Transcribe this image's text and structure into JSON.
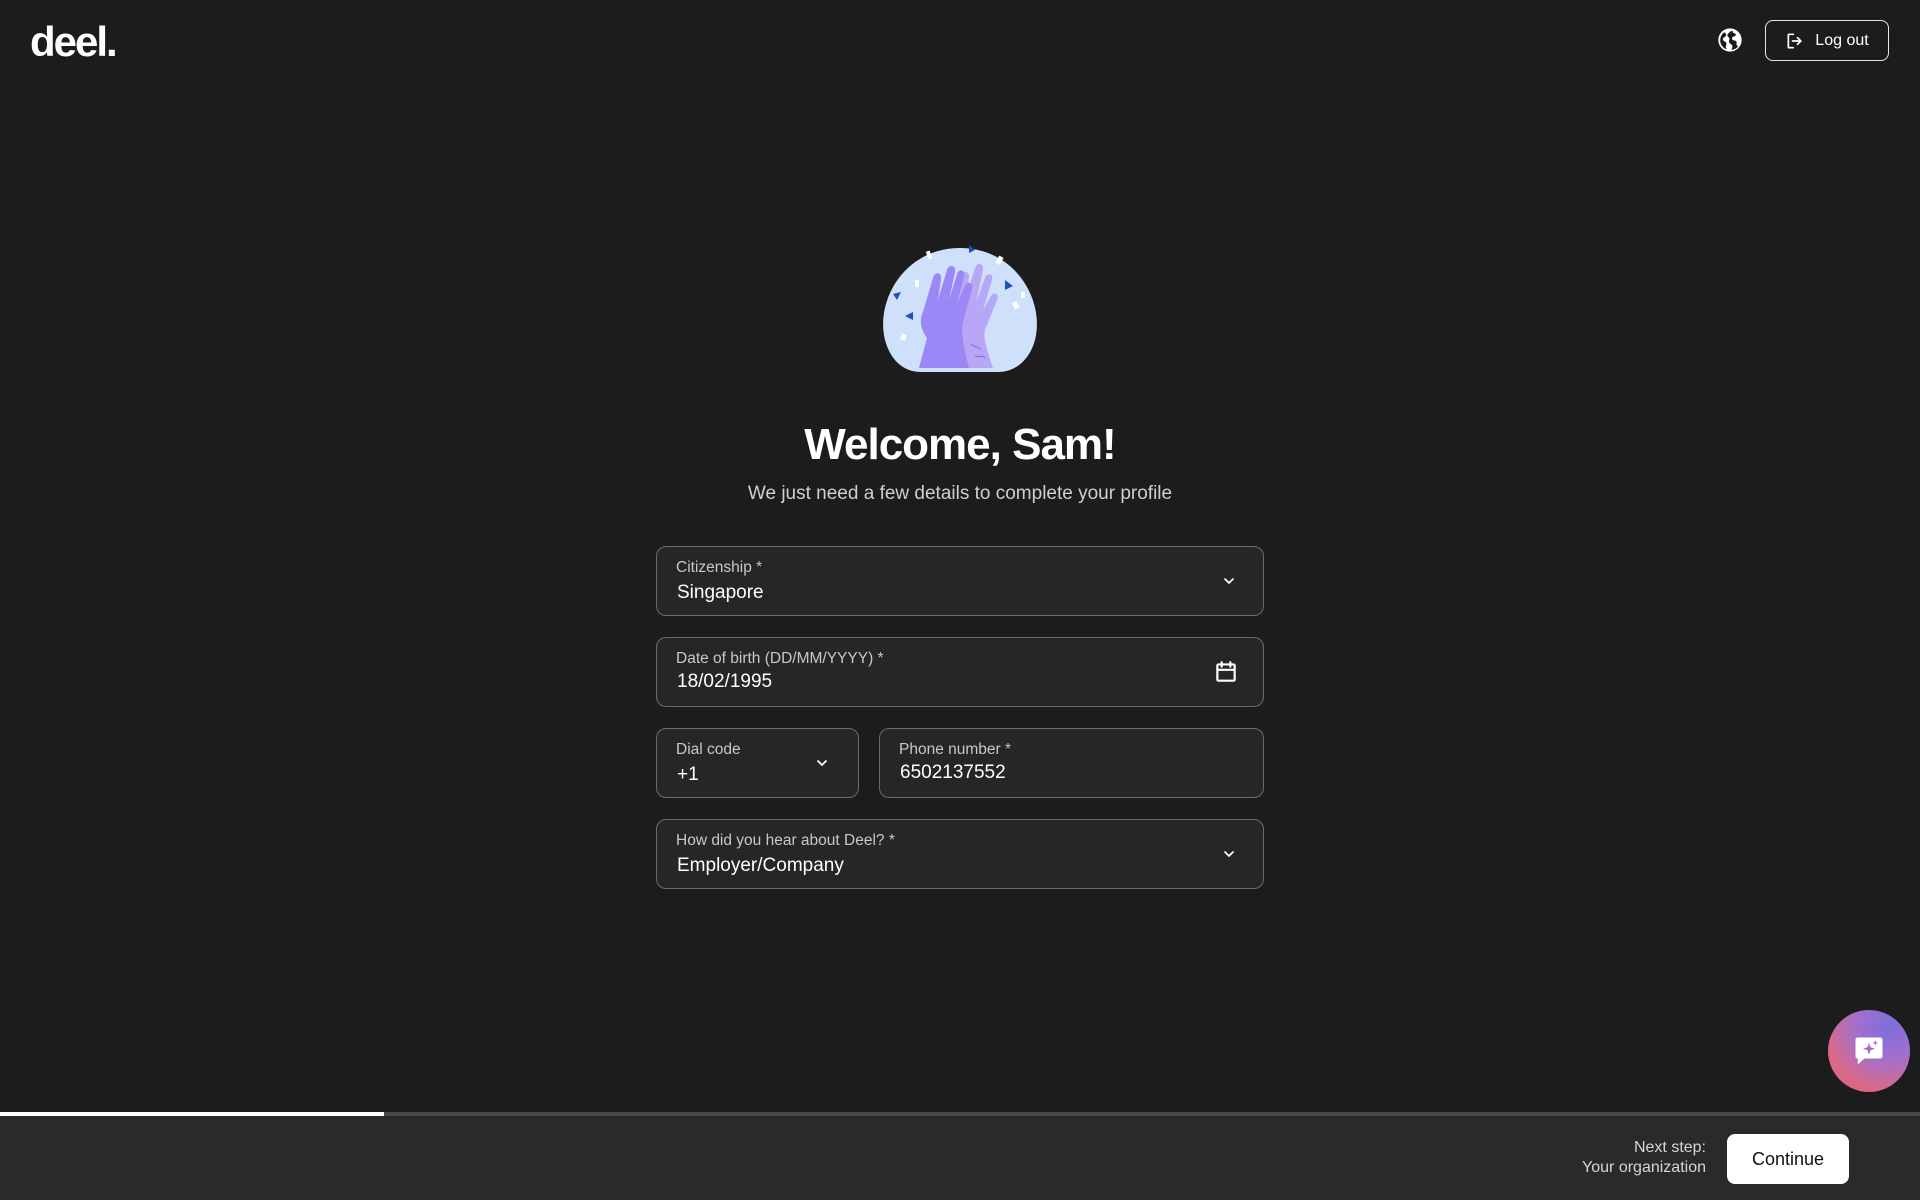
{
  "header": {
    "logo_text": "deel.",
    "language_icon": "globe-icon",
    "logout_label": "Log out",
    "logout_icon": "logout-icon"
  },
  "main": {
    "illustration": "high-five-illustration",
    "title": "Welcome, Sam!",
    "subtitle": "We just need a few details to complete your profile"
  },
  "form": {
    "citizenship": {
      "label": "Citizenship *",
      "value": "Singapore",
      "icon": "chevron-down-icon"
    },
    "dob": {
      "label": "Date of birth (DD/MM/YYYY) *",
      "value": "18/02/1995",
      "icon": "calendar-icon"
    },
    "dial_code": {
      "label": "Dial code",
      "value": "+1",
      "icon": "chevron-down-icon"
    },
    "phone": {
      "label": "Phone number *",
      "value": "6502137552"
    },
    "hear_about": {
      "label": "How did you hear about Deel? *",
      "value": "Employer/Company",
      "icon": "chevron-down-icon"
    }
  },
  "assistant": {
    "icon": "ai-chat-icon"
  },
  "progress": {
    "value": 0.2
  },
  "footer": {
    "next_step_label": "Next step:",
    "next_step_value": "Your organization",
    "continue_label": "Continue"
  },
  "colors": {
    "background": "#1c1c1c",
    "field_background": "#262626",
    "field_border": "#6b6b6b",
    "footer_background": "#2a2a2a",
    "accent_purple": "#9b87f5"
  }
}
